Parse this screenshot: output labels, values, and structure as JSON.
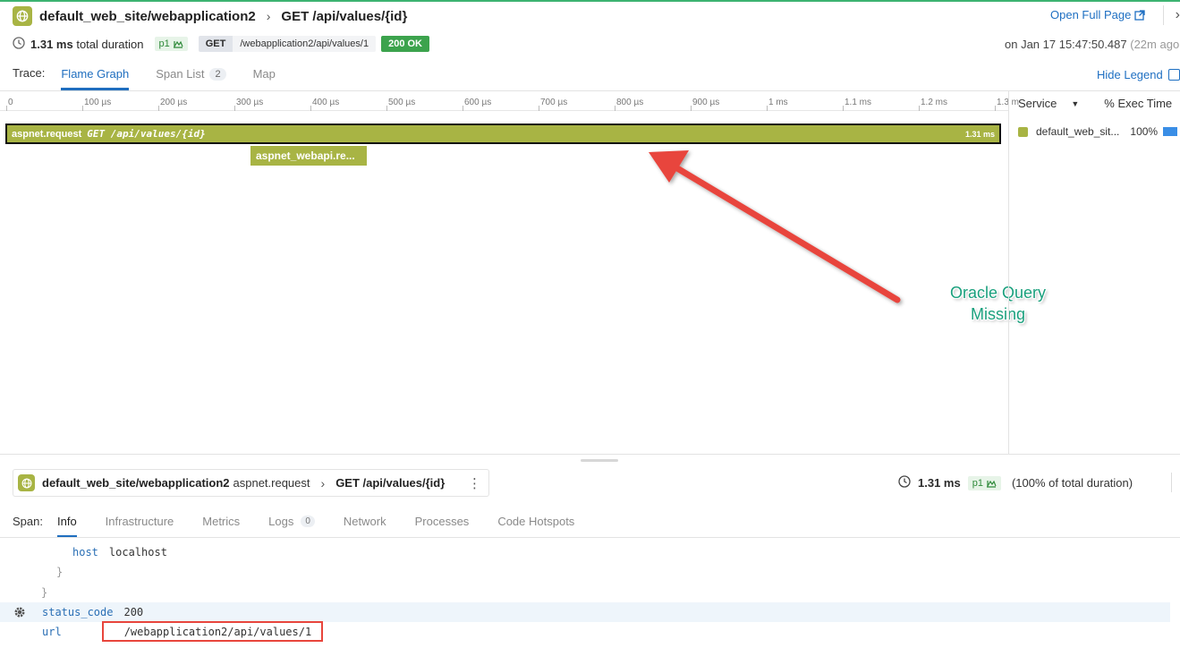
{
  "header": {
    "service_path": "default_web_site/webapplication2",
    "operation": "GET /api/values/{id}",
    "open_full_page": "Open Full Page"
  },
  "summary": {
    "duration": "1.31 ms",
    "duration_suffix": "total duration",
    "priority": "p1",
    "method": "GET",
    "url": "/webapplication2/api/values/1",
    "status": "200 OK",
    "timestamp": "on Jan 17 15:47:50.487",
    "ago": "(22m ago"
  },
  "trace_tabs": {
    "label": "Trace:",
    "flame_graph": "Flame Graph",
    "span_list": "Span List",
    "span_list_count": "2",
    "map": "Map",
    "hide_legend": "Hide Legend"
  },
  "axis_ticks": [
    "0",
    "100 µs",
    "200 µs",
    "300 µs",
    "400 µs",
    "500 µs",
    "600 µs",
    "700 µs",
    "800 µs",
    "900 µs",
    "1 ms",
    "1.1 ms",
    "1.2 ms",
    "1.3 m"
  ],
  "flame": {
    "root_name": "aspnet.request",
    "root_resource": "GET /api/values/{id}",
    "root_duration": "1.31 ms",
    "child_name": "aspnet_webapi.re..."
  },
  "annotation": {
    "line1": "Oracle Query",
    "line2": "Missing",
    "color": "#1aa07d",
    "arrow_color": "#e8453c"
  },
  "legend": {
    "service_header": "Service",
    "exec_header": "% Exec Time",
    "row_service": "default_web_sit...",
    "row_pct": "100%",
    "swatch": "#a8b444",
    "bar": "#3a8ee6"
  },
  "span_detail": {
    "service_path": "default_web_site/webapplication2",
    "operation_name": "aspnet.request",
    "resource": "GET /api/values/{id}",
    "duration": "1.31 ms",
    "priority": "p1",
    "pct_total": "(100% of total duration)"
  },
  "span_tabs": {
    "label": "Span:",
    "info": "Info",
    "infrastructure": "Infrastructure",
    "metrics": "Metrics",
    "logs": "Logs",
    "logs_count": "0",
    "network": "Network",
    "processes": "Processes",
    "code_hotspots": "Code Hotspots"
  },
  "attributes": {
    "host_key": "host",
    "host_val": "localhost",
    "brace_inner": "}",
    "brace_outer": "}",
    "status_key": "status_code",
    "status_val": "200",
    "url_key": "url",
    "url_val": "/webapplication2/api/values/1"
  },
  "colors": {
    "service": "#a8b444",
    "accent": "#1f6ebf",
    "ok": "#3ca34d"
  }
}
